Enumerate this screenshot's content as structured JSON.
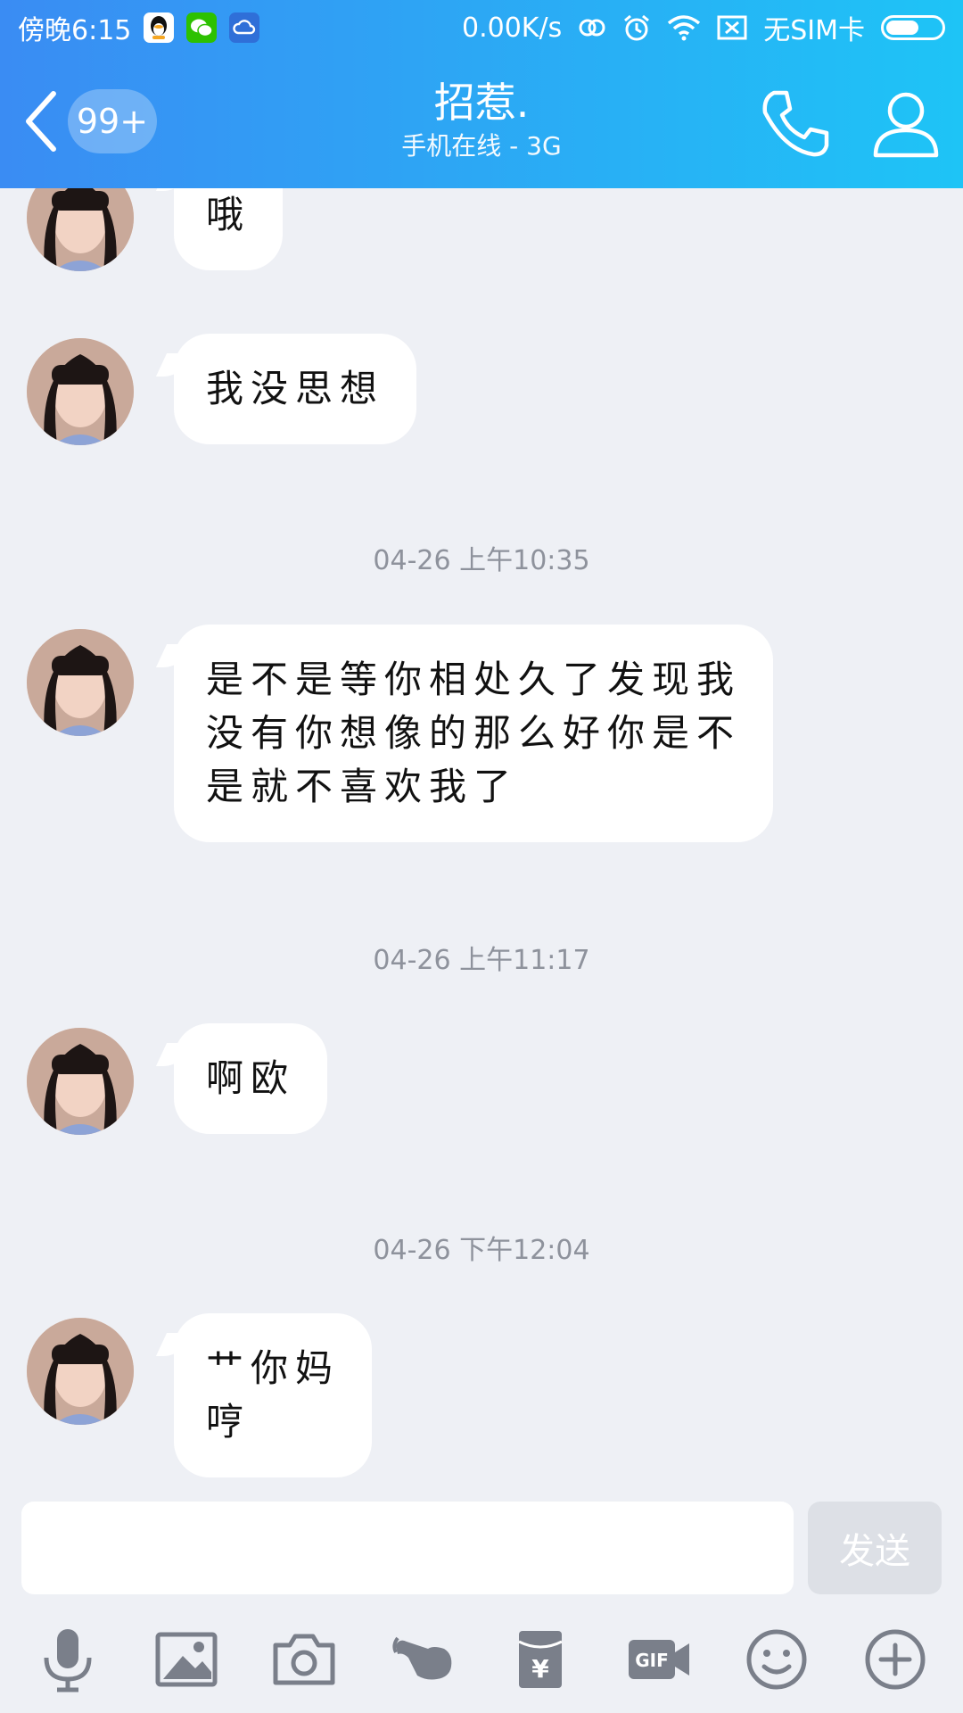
{
  "status_bar": {
    "time": "傍晚6:15",
    "speed": "0.00K/s",
    "sim": "无SIM卡",
    "apps": [
      "qq-icon",
      "wechat-icon",
      "cloud-icon"
    ]
  },
  "header": {
    "unread_count": "99+",
    "contact_name": "招惹.",
    "contact_status": "手机在线 - 3G"
  },
  "messages": [
    {
      "text": "哦"
    },
    {
      "text": "我没思想"
    },
    {
      "timestamp": "04-26 上午10:35"
    },
    {
      "text": "是不是等你相处久了发现我\n没有你想像的那么好你是不\n是就不喜欢我了"
    },
    {
      "timestamp": "04-26 上午11:17"
    },
    {
      "text": "啊欧"
    },
    {
      "timestamp": "04-26 下午12:04"
    },
    {
      "text": "艹你妈\n哼"
    }
  ],
  "input": {
    "value": "",
    "send_label": "发送"
  },
  "toolbar": [
    "microphone-icon",
    "image-icon",
    "camera-icon",
    "poke-icon",
    "red-packet-icon",
    "gif-icon",
    "emoji-icon",
    "plus-icon"
  ],
  "colors": {
    "header_start": "#3a8cf3",
    "header_end": "#1ec4f6",
    "chat_background": "#eef0f5",
    "bubble": "#ffffff",
    "toolbar_icon": "#7a7f8a"
  }
}
